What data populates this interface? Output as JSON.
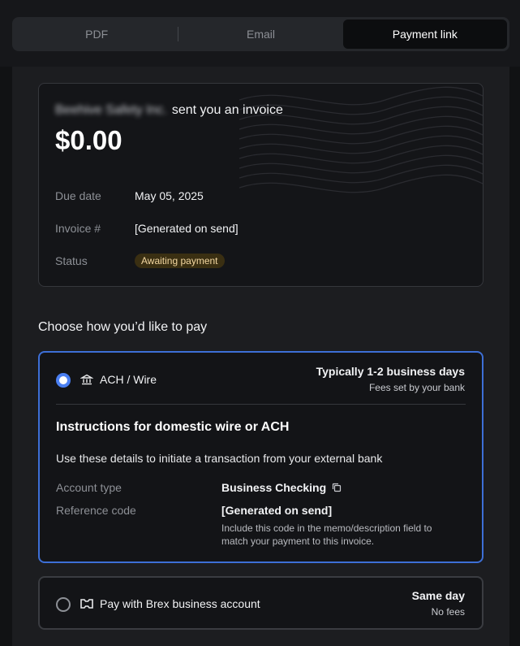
{
  "tabs": [
    {
      "label": "PDF",
      "active": false
    },
    {
      "label": "Email",
      "active": false
    },
    {
      "label": "Payment link",
      "active": true
    }
  ],
  "invoice": {
    "sender_name": "Beehive Safety Inc.",
    "sender_suffix": "sent you an invoice",
    "amount": "$0.00",
    "due_date_label": "Due date",
    "due_date_value": "May 05, 2025",
    "invoice_no_label": "Invoice #",
    "invoice_no_value": "[Generated on send]",
    "status_label": "Status",
    "status_value": "Awaiting payment"
  },
  "pay_section": {
    "title": "Choose how you’d like to pay"
  },
  "ach_option": {
    "selected": true,
    "label": "ACH / Wire",
    "timing": "Typically 1-2 business days",
    "fees": "Fees set by your bank",
    "instructions_title": "Instructions for domestic wire or ACH",
    "instructions_desc": "Use these details to initiate a transaction from your external bank",
    "account_type_label": "Account type",
    "account_type_value": "Business Checking",
    "reference_label": "Reference code",
    "reference_value": "[Generated on send]",
    "reference_note": "Include this code in the memo/description field to match your payment to this invoice."
  },
  "brex_option": {
    "selected": false,
    "label": "Pay with Brex business account",
    "timing": "Same day",
    "fees": "No fees"
  },
  "colors": {
    "accent": "#4a7ff2",
    "badge_bg": "#3a2f12",
    "badge_text": "#f3d7a0"
  }
}
